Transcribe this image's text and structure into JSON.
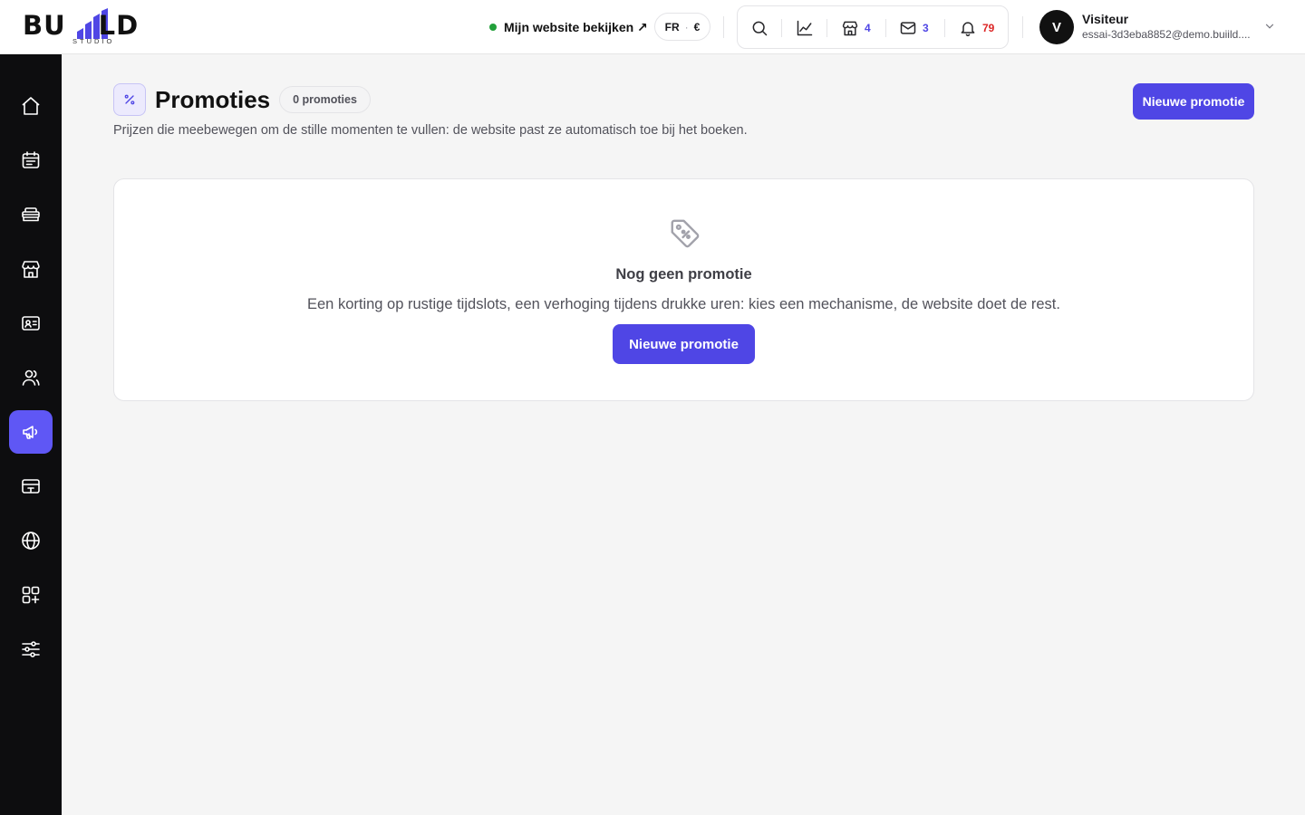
{
  "brand": {
    "logo_text": "BUILD",
    "logo_sub": "STUDIO",
    "accent": "#4f46e5"
  },
  "topbar": {
    "site_link": "Mijn website bekijken ↗",
    "lang": "FR",
    "currency": "€",
    "tools": {
      "search_icon": "search-icon",
      "stats_icon": "chart-icon",
      "store_count": "4",
      "mail_count": "3",
      "notif_count": "79"
    },
    "user": {
      "initial": "V",
      "name": "Visiteur",
      "email": "essai-3d3eba8852@demo.buiild...."
    }
  },
  "sidebar": {
    "items": [
      {
        "name": "home"
      },
      {
        "name": "calendar"
      },
      {
        "name": "services"
      },
      {
        "name": "shop"
      },
      {
        "name": "contacts"
      },
      {
        "name": "team"
      },
      {
        "name": "promotions",
        "active": true
      },
      {
        "name": "payments"
      },
      {
        "name": "website"
      },
      {
        "name": "apps"
      },
      {
        "name": "settings"
      }
    ]
  },
  "page": {
    "icon": "percent-icon",
    "title": "Promoties",
    "count_label": "0 promoties",
    "description": "Prijzen die meebewegen om de stille momenten te vullen: de website past ze automatisch toe bij het boeken.",
    "new_button": "Nieuwe promotie"
  },
  "empty_state": {
    "icon": "tag-icon",
    "title": "Nog geen promotie",
    "description": "Een korting op rustige tijdslots, een verhoging tijdens drukke uren: kies een mechanisme, de website doet de rest.",
    "button": "Nieuwe promotie"
  }
}
